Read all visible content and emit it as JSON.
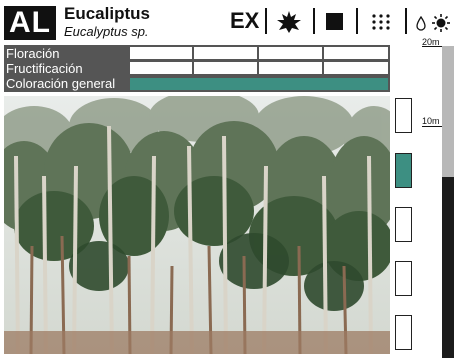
{
  "header": {
    "code": "AL",
    "common_name": "Eucaliptus",
    "scientific_name": "Eucalyptus sp.",
    "status": "EX",
    "icons": [
      "evergreen-leaf-icon",
      "full-sun-icon",
      "grid-dots-icon",
      "water-drop-icon",
      "sun-icon"
    ]
  },
  "phenology": {
    "rows": [
      {
        "label": "Floración"
      },
      {
        "label": "Fructificación"
      },
      {
        "label": "Coloración general"
      }
    ]
  },
  "colors": {
    "accent": "#3d8f82",
    "header_bg": "#555555",
    "scale_bar": "#1c1c1c"
  },
  "color_boxes": [
    {
      "filled": false
    },
    {
      "filled": true,
      "color": "#3d8f82"
    },
    {
      "filled": false
    },
    {
      "filled": false
    },
    {
      "filled": false
    }
  ],
  "height_scale": {
    "top_label": "20m",
    "mid_label": "10m",
    "tree_height_fraction": 0.58
  }
}
